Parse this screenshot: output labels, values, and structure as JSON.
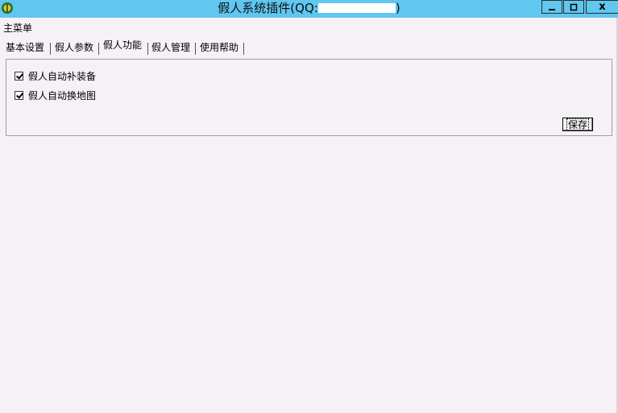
{
  "window": {
    "title": "假人系统插件(QQ:",
    "title_suffix": ")",
    "title_redacted": true,
    "controls": {
      "minimize": "—",
      "maximize": "□",
      "close": "x"
    },
    "icon": "app-icon"
  },
  "menu": {
    "main": "主菜单"
  },
  "tabs": [
    {
      "label": "基本设置",
      "active": false
    },
    {
      "label": "假人参数",
      "active": false
    },
    {
      "label": "假人功能",
      "active": true
    },
    {
      "label": "假人管理",
      "active": false
    },
    {
      "label": "使用帮助",
      "active": false
    }
  ],
  "panel": {
    "options": [
      {
        "label": "假人自动补装备",
        "checked": true
      },
      {
        "label": "假人自动换地图",
        "checked": true
      }
    ],
    "save_label": "保存"
  },
  "colors": {
    "titlebar": "#5fc7f0",
    "background": "#f6f1f6"
  }
}
